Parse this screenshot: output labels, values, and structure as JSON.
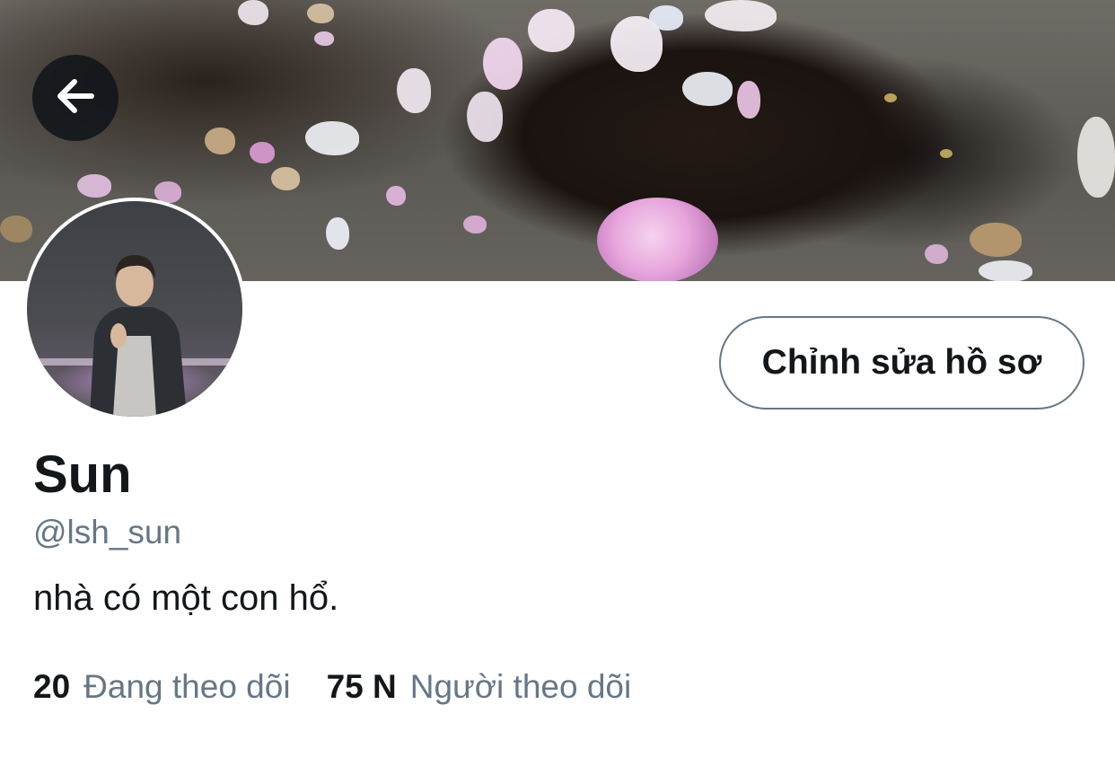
{
  "profile": {
    "display_name": "Sun",
    "handle": "@lsh_sun",
    "bio": "nhà có một con hổ.",
    "edit_button_label": "Chỉnh sửa hồ sơ",
    "following_count": "20",
    "following_label": "Đang theo dõi",
    "followers_count": "75 N",
    "followers_label": "Người theo dõi"
  },
  "icons": {
    "back": "arrow-left-icon"
  },
  "colors": {
    "primary_text": "#14171a",
    "secondary_text": "#657786",
    "button_border": "#657786",
    "background": "#ffffff"
  }
}
